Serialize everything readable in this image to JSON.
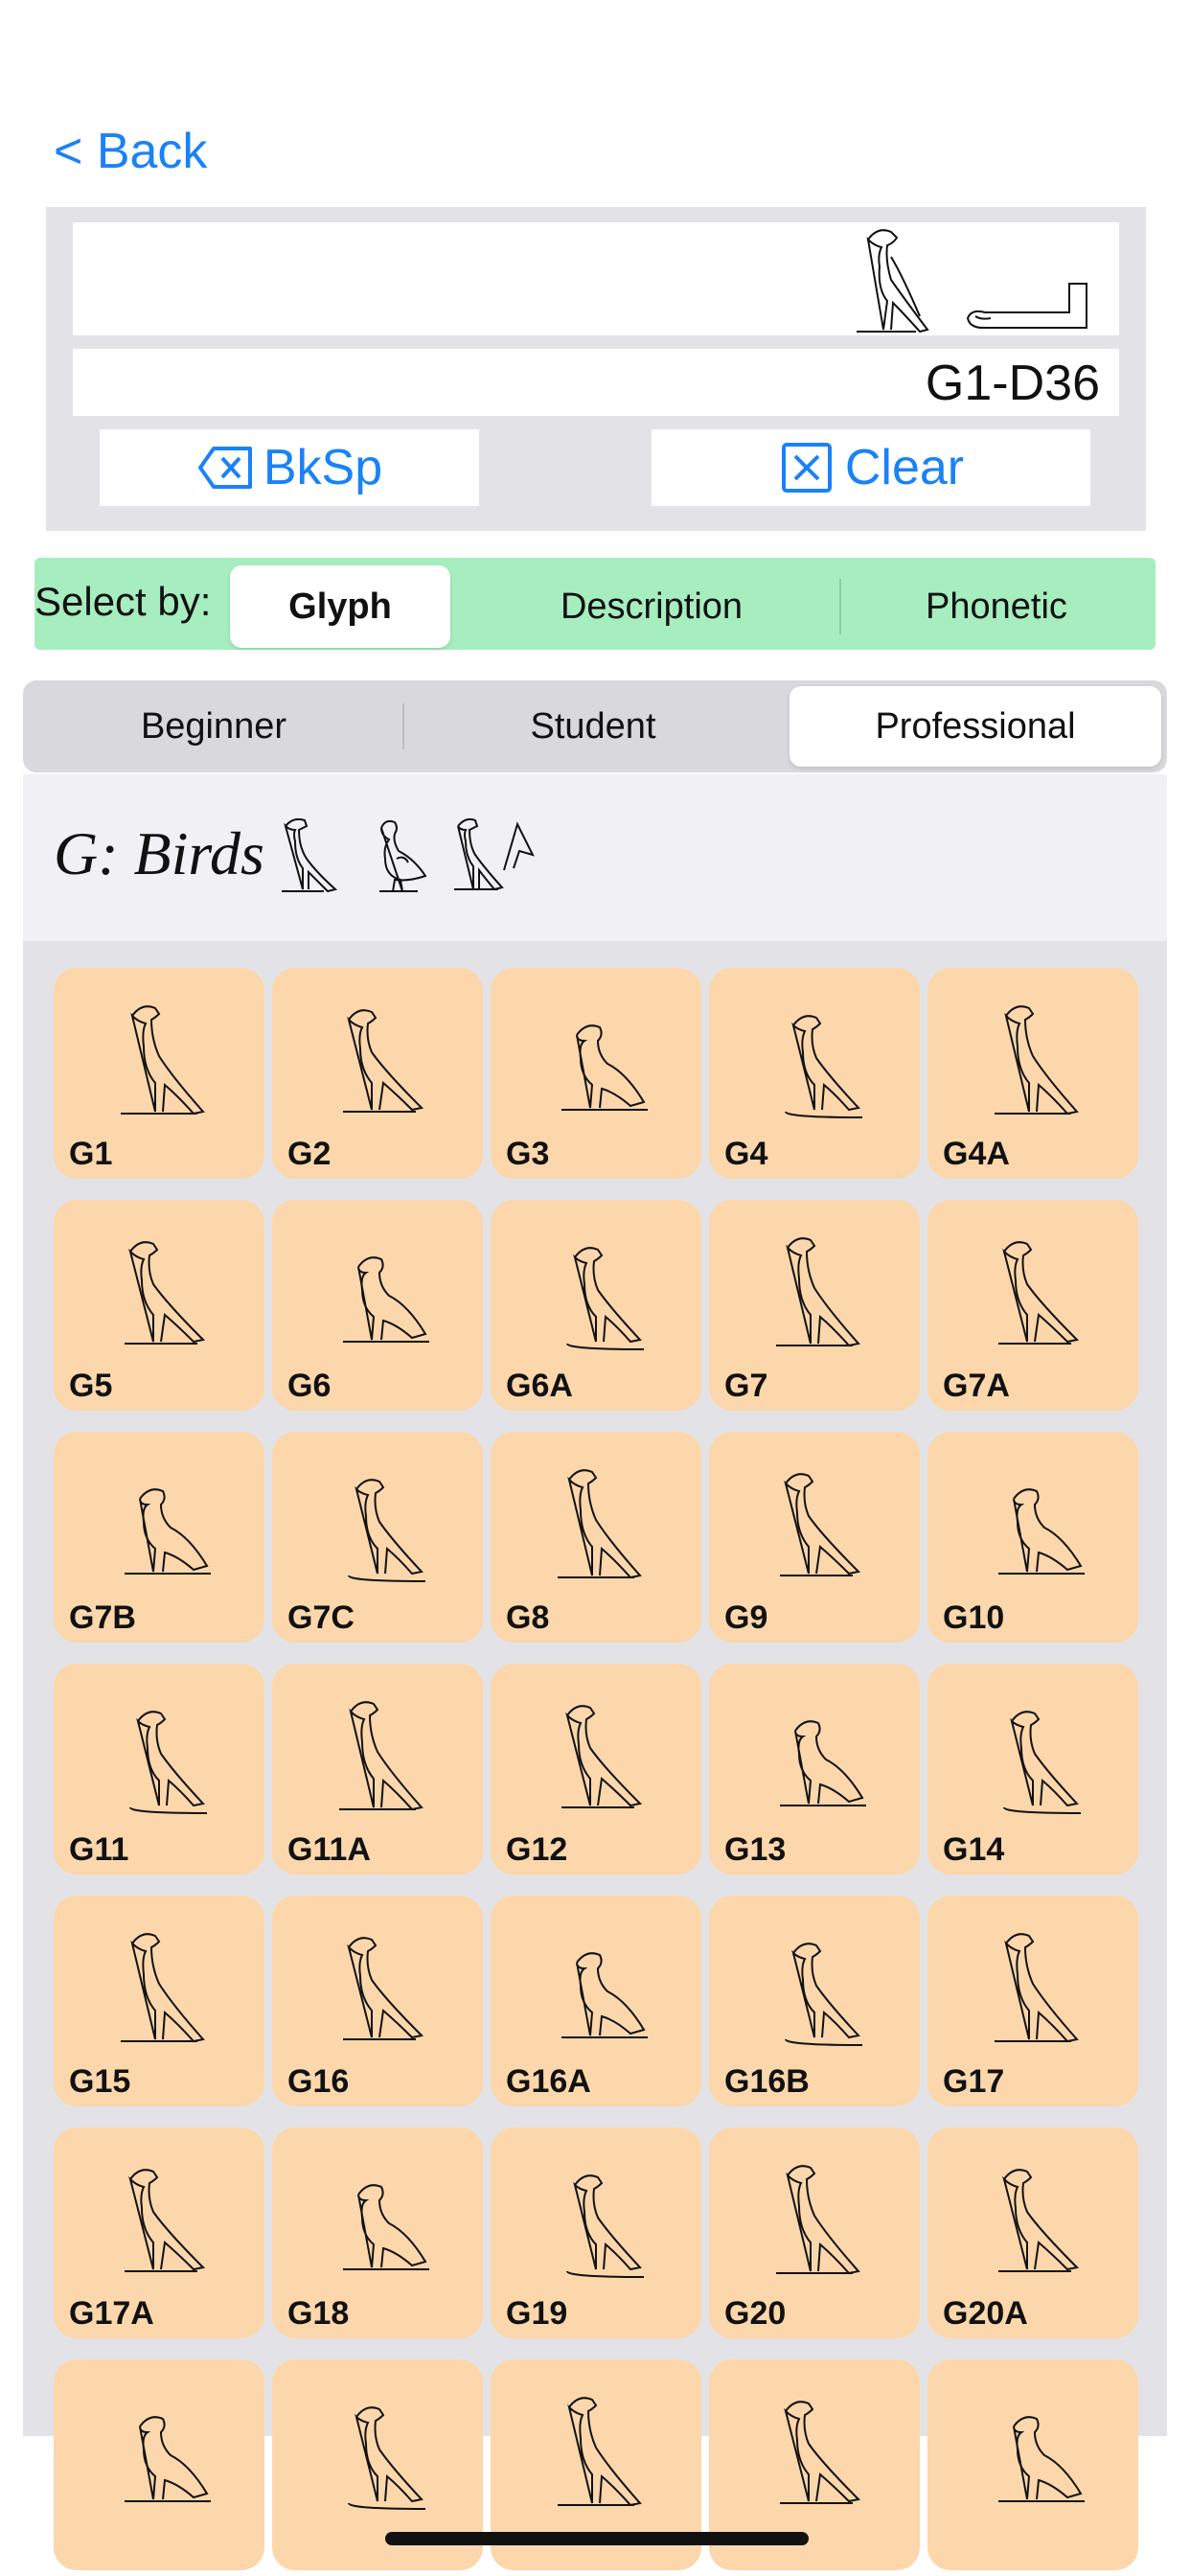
{
  "nav": {
    "back_label": "< Back"
  },
  "entry": {
    "code_text": "G1-D36",
    "backspace_label": "BkSp",
    "clear_label": "Clear"
  },
  "select_by": {
    "label": "Select by:",
    "options": [
      "Glyph",
      "Description",
      "Phonetic"
    ],
    "selected": "Glyph"
  },
  "levels": {
    "options": [
      "Beginner",
      "Student",
      "Professional"
    ],
    "selected": "Professional"
  },
  "category": {
    "title": "G: Birds"
  },
  "glyphs": [
    "G1",
    "G2",
    "G3",
    "G4",
    "G4A",
    "G5",
    "G6",
    "G6A",
    "G7",
    "G7A",
    "G7B",
    "G7C",
    "G8",
    "G9",
    "G10",
    "G11",
    "G11A",
    "G12",
    "G13",
    "G14",
    "G15",
    "G16",
    "G16A",
    "G16B",
    "G17",
    "G17A",
    "G18",
    "G19",
    "G20",
    "G20A",
    "",
    "",
    "",
    "",
    ""
  ],
  "colors": {
    "accent": "#1a82f7",
    "select_bar": "#a6edbf",
    "cell": "#fcd7ab",
    "panel": "#e3e3e7"
  }
}
